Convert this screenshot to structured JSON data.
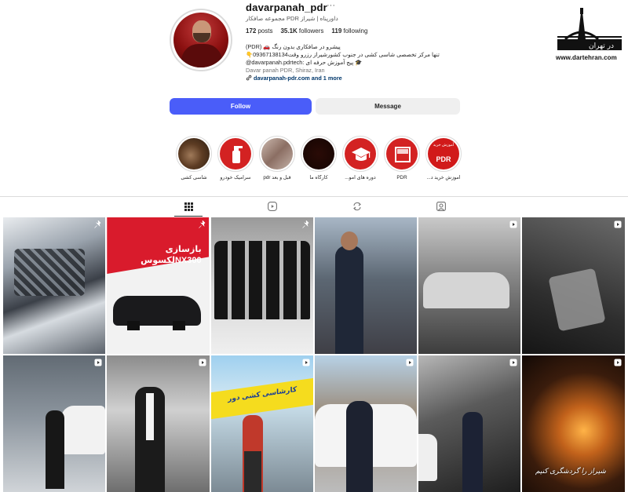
{
  "profile": {
    "username": "davarpanah_pdr",
    "more_icon": "···",
    "category": "داورپناه | شیراز PDR مجموعه صافکار",
    "stats": {
      "posts_value": "172",
      "posts_label": "posts",
      "followers_value": "35.1K",
      "followers_label": "followers",
      "following_value": "119",
      "following_label": "following"
    },
    "bio": {
      "line1": "(PDR) 🚗 پیشرو در صافکاری بدون رنگ",
      "line2": "تنها مرکز تخصصی شاسی کشی در جنوب کشورشیراز رزرو وقت09367138134👇",
      "line3": "🎓 پیج آموزش حرفه ای :davarpanah.pdrtech@",
      "address": "Davar panah PDR, Shiraz, Iran",
      "link": "davarpanah-pdr.com and 1 more"
    }
  },
  "actions": {
    "follow_label": "Follow",
    "message_label": "Message"
  },
  "highlights": [
    {
      "label": "شاسی کشی"
    },
    {
      "label": "سرامیک خودرو"
    },
    {
      "label": "قبل و بعد pdr"
    },
    {
      "label": "کارگاه ما"
    },
    {
      "label": "دوره های آمو..."
    },
    {
      "label": "PDR"
    },
    {
      "label": "آموزش خرید د..."
    }
  ],
  "highlight_pdr_cover": {
    "line1": "آموزش خرید",
    "line2": "ماشین",
    "big": "PDR"
  },
  "tabs": [
    {
      "name": "posts",
      "icon": "grid-icon",
      "active": true
    },
    {
      "name": "reels",
      "icon": "reels-icon",
      "active": false
    },
    {
      "name": "reposts",
      "icon": "repost-icon",
      "active": false
    },
    {
      "name": "tagged",
      "icon": "tagged-icon",
      "active": false
    }
  ],
  "posts": [
    {
      "type": "pinned"
    },
    {
      "type": "pinned",
      "overlay_line1": "بازسازی",
      "overlay_line2": "لکسوسNX300"
    },
    {
      "type": "pinned"
    },
    {
      "type": "photo"
    },
    {
      "type": "reel"
    },
    {
      "type": "reel"
    },
    {
      "type": "reel"
    },
    {
      "type": "reel"
    },
    {
      "type": "reel",
      "sign_text": "کارشاسی کشی دور"
    },
    {
      "type": "reel"
    },
    {
      "type": "reel"
    },
    {
      "type": "reel"
    }
  ],
  "watermark": {
    "brand": "در تهران",
    "url": "www.dartehran.com",
    "signature": "شیراز را گردشگری کنیم"
  },
  "colors": {
    "follow_bg": "#4a5df9",
    "message_bg": "#efefef",
    "brand_red": "#d32222"
  }
}
